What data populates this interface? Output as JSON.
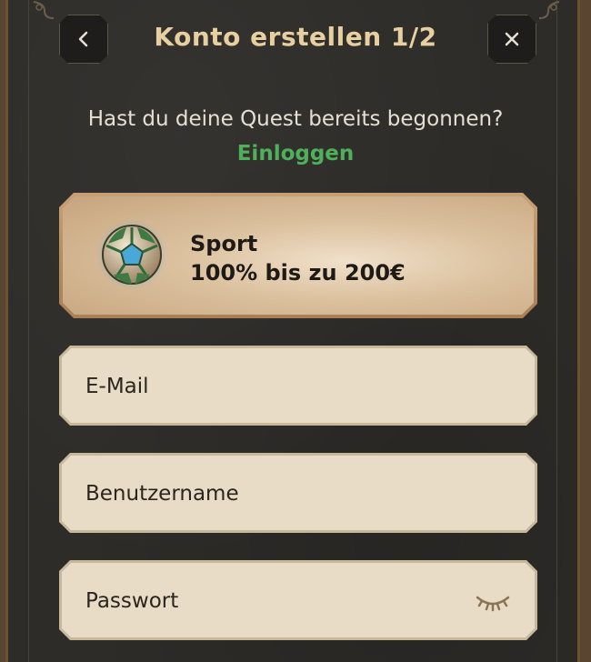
{
  "header": {
    "title": "Konto erstellen 1/2",
    "back_icon": "chevron-left-icon",
    "close_icon": "close-icon"
  },
  "login_prompt": {
    "text": "Hast du deine Quest bereits begonnen?",
    "link": "Einloggen",
    "link_color": "#4fb05a"
  },
  "promo": {
    "icon": "soccer-ball-icon",
    "title": "Sport",
    "subtitle": "100% bis zu 200€"
  },
  "form": {
    "email_placeholder": "E-Mail",
    "username_placeholder": "Benutzername",
    "password_placeholder": "Passwort",
    "password_toggle_icon": "eye-closed-icon"
  },
  "colors": {
    "title": "#e8cf9f",
    "background": "#2e2c29",
    "field_fill": "#e8dcc6",
    "promo_fill": "#dcc2a0"
  }
}
